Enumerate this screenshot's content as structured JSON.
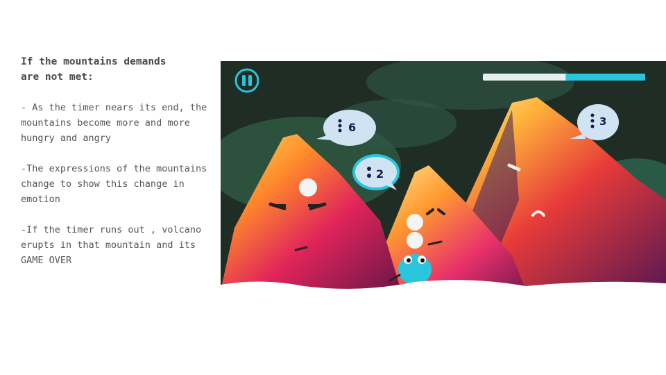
{
  "slide": {
    "heading": "If the mountains demands\nare not met:",
    "bullets": [
      "- As the timer nears its end, the mountains become more and more hungry and angry",
      "-The expressions of the mountains change to show this change in emotion",
      "-If the timer runs out , volcano erupts in that mountain and its GAME OVER"
    ]
  },
  "game": {
    "pause_icon": "pause-icon",
    "timer_progress": 0.49,
    "colors": {
      "accent": "#29c5dc",
      "bubble": "#cfe3f3",
      "sky": "#1f2d25"
    },
    "demands": [
      {
        "id": "left",
        "count": "6",
        "dots": 3
      },
      {
        "id": "middle",
        "count": "2",
        "dots": 2
      },
      {
        "id": "right",
        "count": "3",
        "dots": 3
      }
    ]
  }
}
